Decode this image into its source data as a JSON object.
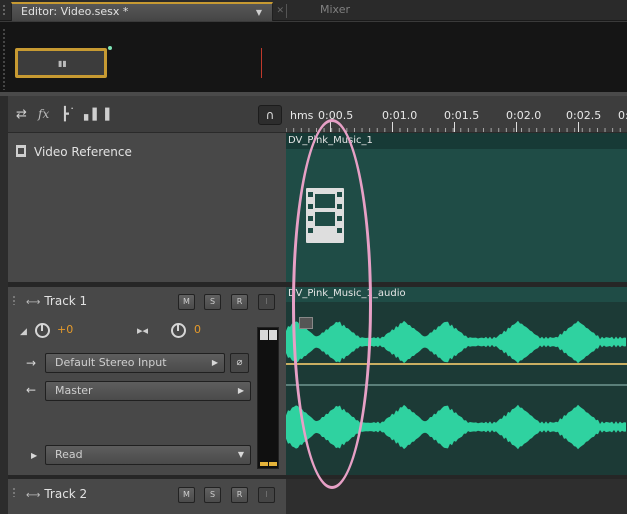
{
  "tabs": {
    "editor_label": "Editor: Video.sesx *",
    "mixer_label": "Mixer"
  },
  "toolbar": {
    "icons": [
      "swap-arrows-icon",
      "fx-icon",
      "send-icon",
      "eq-icon",
      "headphones-icon"
    ],
    "fx_label": "fx"
  },
  "ruler": {
    "unit": "hms",
    "labels": [
      "0:00.5",
      "0:01.0",
      "0:01.5",
      "0:02.0",
      "0:02.5",
      "0:"
    ]
  },
  "video_track": {
    "name": "Video Reference",
    "clip_title": "DV_Pink_Music_1"
  },
  "track1": {
    "name": "Track 1",
    "buttons": [
      "M",
      "S",
      "R"
    ],
    "volume_value": "+0",
    "pan_value": "0",
    "input": "Default Stereo Input",
    "output": "Master",
    "automation": "Read",
    "clip_title": "DV_Pink_Music_1_audio"
  },
  "track2": {
    "name": "Track 2",
    "buttons": [
      "M",
      "S",
      "R"
    ]
  },
  "colors": {
    "accent": "#c79a32",
    "waveform": "#2fd2a0",
    "clip_bg": "#1f4c46",
    "value_orange": "#e59a2b",
    "annotation": "#e7a0c6"
  }
}
